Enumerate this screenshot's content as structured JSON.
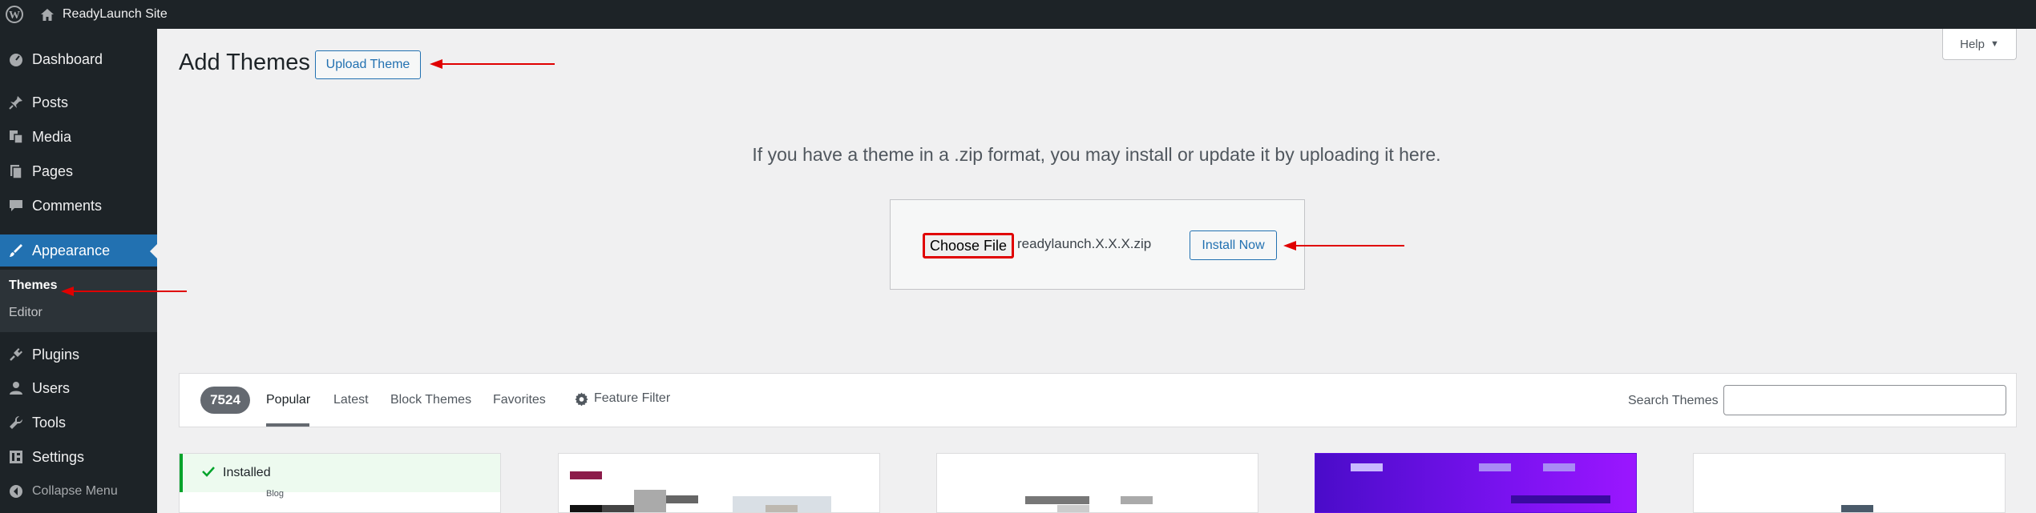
{
  "adminbar": {
    "site_name": "ReadyLaunch Site"
  },
  "sidebar": {
    "items": [
      {
        "label": "Dashboard",
        "icon": "dashboard-icon"
      },
      {
        "label": "Posts",
        "icon": "pin-icon"
      },
      {
        "label": "Media",
        "icon": "media-icon"
      },
      {
        "label": "Pages",
        "icon": "pages-icon"
      },
      {
        "label": "Comments",
        "icon": "comment-icon"
      },
      {
        "label": "Appearance",
        "icon": "brush-icon",
        "active": true
      },
      {
        "label": "Plugins",
        "icon": "plug-icon"
      },
      {
        "label": "Users",
        "icon": "user-icon"
      },
      {
        "label": "Tools",
        "icon": "wrench-icon"
      },
      {
        "label": "Settings",
        "icon": "settings-icon"
      }
    ],
    "submenu": [
      {
        "label": "Themes",
        "current": true
      },
      {
        "label": "Editor"
      }
    ],
    "collapse_label": "Collapse Menu"
  },
  "page": {
    "title": "Add Themes",
    "upload_button": "Upload Theme",
    "help_label": "Help",
    "upload_description": "If you have a theme in a .zip format, you may install or update it by uploading it here.",
    "choose_file_label": "Choose File",
    "file_name": "readylaunch.X.X.X.zip",
    "install_button": "Install Now"
  },
  "filter": {
    "count": "7524",
    "tabs": [
      "Popular",
      "Latest",
      "Block Themes",
      "Favorites"
    ],
    "feature_filter": "Feature Filter",
    "search_label": "Search Themes",
    "search_value": ""
  },
  "themes": {
    "installed_label": "Installed",
    "installed_preview_text": "Blog"
  },
  "colors": {
    "admin_dark": "#1d2327",
    "accent": "#2271b1",
    "annotation_red": "#e00000",
    "installed_green": "#00a32a"
  }
}
